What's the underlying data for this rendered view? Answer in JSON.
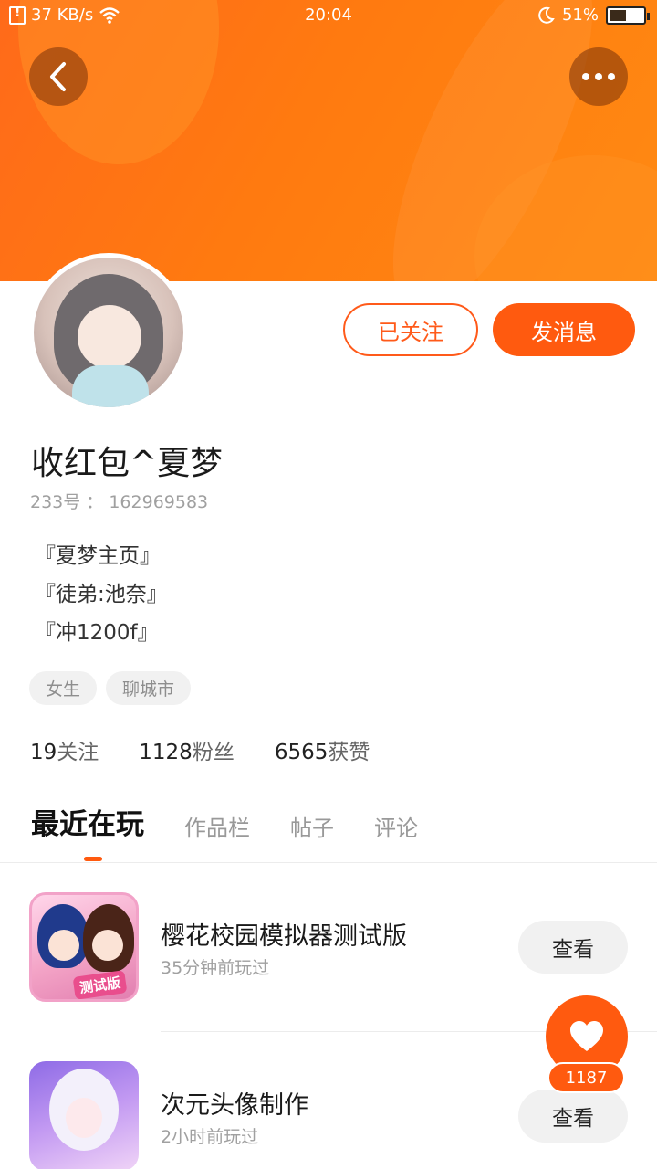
{
  "status_bar": {
    "speed": "37 KB/s",
    "time": "20:04",
    "battery": "51%",
    "battery_level": 0.51
  },
  "header": {
    "back_icon": "chevron-left-icon",
    "more_icon": "more-dots-icon",
    "brand_color": "#ff5a0f"
  },
  "profile": {
    "name": "收红包^夏梦",
    "uid": "233号 ： 162969583",
    "bio": [
      "『夏梦主页』",
      "『徒弟:池奈』",
      "『冲1200f』"
    ],
    "tags": [
      "女生",
      "聊城市"
    ],
    "stats": [
      {
        "value": "19",
        "label": "关注"
      },
      {
        "value": "1128",
        "label": "粉丝"
      },
      {
        "value": "6565",
        "label": "获赞"
      }
    ]
  },
  "actions": {
    "followed_label": "已关注",
    "message_label": "发消息"
  },
  "tabs": [
    "最近在玩",
    "作品栏",
    "帖子",
    "评论"
  ],
  "games": [
    {
      "title": "樱花校园模拟器测试版",
      "time": "35分钟前玩过",
      "button": "查看",
      "icon_badge": "测试版"
    },
    {
      "title": "次元头像制作",
      "time": "2小时前玩过",
      "button": "查看"
    }
  ],
  "like": {
    "count": "1187",
    "icon": "heart-icon"
  }
}
